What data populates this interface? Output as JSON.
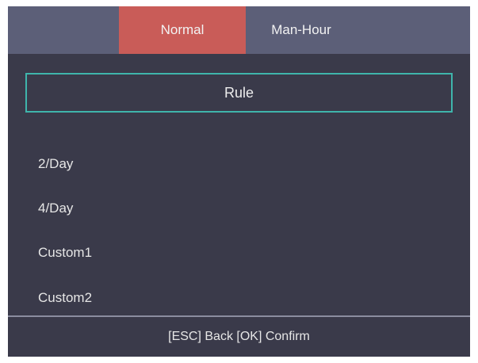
{
  "tabs": {
    "normal": "Normal",
    "man_hour": "Man-Hour",
    "active": "Normal"
  },
  "rule": {
    "label": "Rule"
  },
  "list": {
    "items": [
      "2/Day",
      "4/Day",
      "Custom1",
      "Custom2"
    ]
  },
  "footer": {
    "hint": "[ESC] Back [OK] Confirm"
  },
  "colors": {
    "background": "#3a3a4a",
    "tabbar": "#5c5f78",
    "active_tab": "#c95c58",
    "focus_border": "#3fb5ac",
    "text": "#e6e6e6"
  }
}
